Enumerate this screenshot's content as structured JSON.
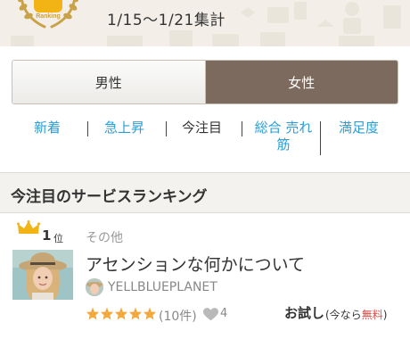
{
  "header": {
    "badge_label": "Ranking",
    "period": "1/15～1/21集計"
  },
  "gender_toggle": {
    "options": [
      {
        "label": "男性",
        "selected": false
      },
      {
        "label": "女性",
        "selected": true
      }
    ],
    "selected_color": "#7d6a5e"
  },
  "sort_tabs": [
    {
      "label": "新着",
      "active": false
    },
    {
      "label": "急上昇",
      "active": false
    },
    {
      "label": "今注目",
      "active": true
    },
    {
      "label_line1": "総合 売れ",
      "label_line2": "筋",
      "active": false
    },
    {
      "label": "満足度",
      "active": false
    }
  ],
  "section": {
    "title": "今注目のサービスランキング"
  },
  "ranking": [
    {
      "rank": "1",
      "rank_unit": "位",
      "category": "その他",
      "title": "アセンションな何かについて",
      "seller": "YELLBLUEPLANET",
      "rating_stars": 5,
      "reviews": "(10件)",
      "favorites": "4",
      "trial_label": "お試し",
      "trial_note_prefix": "(今なら",
      "trial_note_free": "無料",
      "trial_note_suffix": ")"
    }
  ],
  "colors": {
    "link": "#2a9ed6",
    "star": "#f2a93b",
    "crown": "#f2b315",
    "free": "#d9534f"
  }
}
